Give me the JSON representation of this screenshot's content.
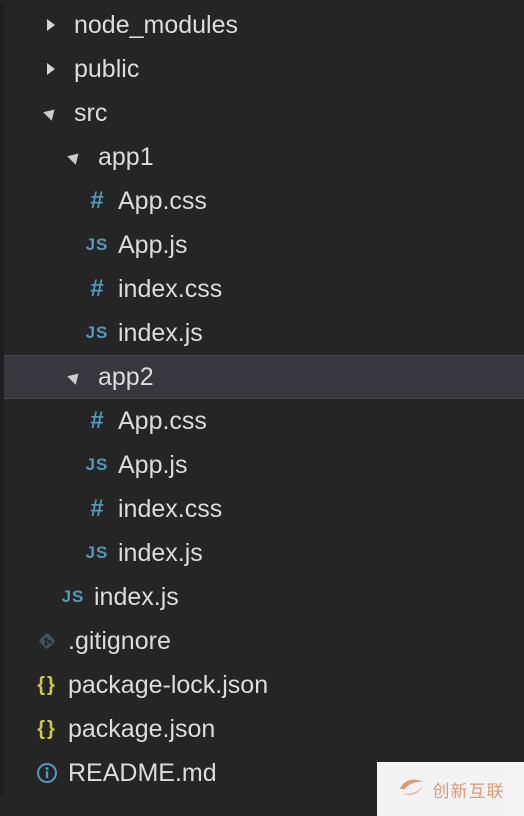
{
  "explorer": {
    "items": [
      {
        "label": "node_modules",
        "kind": "folder",
        "expanded": false,
        "icon": "chevron-right-icon"
      },
      {
        "label": "public",
        "kind": "folder",
        "expanded": false,
        "icon": "chevron-right-icon"
      },
      {
        "label": "src",
        "kind": "folder",
        "expanded": true,
        "icon": "chevron-down-icon"
      },
      {
        "label": "app1",
        "kind": "folder",
        "expanded": true,
        "icon": "chevron-down-icon"
      },
      {
        "label": "App.css",
        "kind": "file",
        "icon": "css-file-icon",
        "glyph": "#"
      },
      {
        "label": "App.js",
        "kind": "file",
        "icon": "js-file-icon",
        "glyph": "JS"
      },
      {
        "label": "index.css",
        "kind": "file",
        "icon": "css-file-icon",
        "glyph": "#"
      },
      {
        "label": "index.js",
        "kind": "file",
        "icon": "js-file-icon",
        "glyph": "JS"
      },
      {
        "label": "app2",
        "kind": "folder",
        "expanded": true,
        "selected": true,
        "icon": "chevron-down-icon"
      },
      {
        "label": "App.css",
        "kind": "file",
        "icon": "css-file-icon",
        "glyph": "#"
      },
      {
        "label": "App.js",
        "kind": "file",
        "icon": "js-file-icon",
        "glyph": "JS"
      },
      {
        "label": "index.css",
        "kind": "file",
        "icon": "css-file-icon",
        "glyph": "#"
      },
      {
        "label": "index.js",
        "kind": "file",
        "icon": "js-file-icon",
        "glyph": "JS"
      },
      {
        "label": "index.js",
        "kind": "file",
        "icon": "js-file-icon",
        "glyph": "JS"
      },
      {
        "label": ".gitignore",
        "kind": "file",
        "icon": "git-file-icon"
      },
      {
        "label": "package-lock.json",
        "kind": "file",
        "icon": "json-file-icon",
        "glyph": "{}"
      },
      {
        "label": "package.json",
        "kind": "file",
        "icon": "json-file-icon",
        "glyph": "{}"
      },
      {
        "label": "README.md",
        "kind": "file",
        "icon": "info-file-icon"
      }
    ]
  },
  "watermark": {
    "text": "创新互联"
  },
  "colors": {
    "background": "#252526",
    "selected_row": "#37373d",
    "icon_blue": "#519aba",
    "icon_yellow": "#cbcb41",
    "git_icon": "#41535b",
    "text": "#dcdcdc"
  }
}
